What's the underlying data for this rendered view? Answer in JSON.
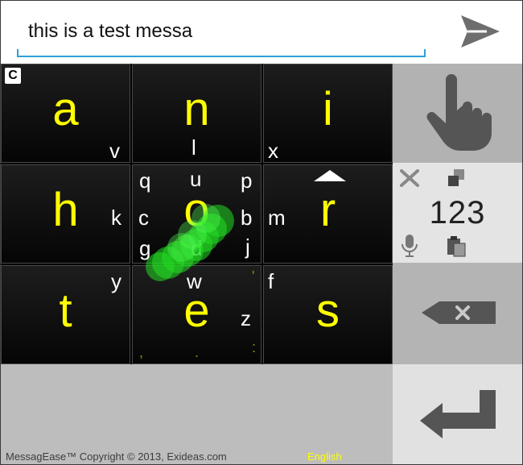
{
  "input": {
    "text": "this is a test messa"
  },
  "keyboard": {
    "mode_badge": "C",
    "cells": [
      {
        "main": "a",
        "subs": [
          "v"
        ]
      },
      {
        "main": "n",
        "subs": [
          "l"
        ]
      },
      {
        "main": "i",
        "subs": [
          "x"
        ]
      },
      {
        "main": "h",
        "subs": [
          "k"
        ]
      },
      {
        "main": "o",
        "subs": [
          "q",
          "u",
          "p",
          "c",
          "b",
          "g",
          "d",
          "j"
        ]
      },
      {
        "main": "r",
        "subs": [
          "m"
        ]
      },
      {
        "main": "t",
        "subs": [
          "y"
        ]
      },
      {
        "main": "e",
        "subs": [
          "w",
          "z",
          "'"
        ]
      },
      {
        "main": "s",
        "subs": [
          "f"
        ]
      }
    ],
    "punct_marks": [
      ",",
      ".",
      ":"
    ],
    "numbers_label": "123"
  },
  "footer": {
    "copyright": "MessagEase™ Copyright © 2013, Exideas.com",
    "language": "English"
  },
  "colors": {
    "accent_underline": "#2d9fd9",
    "letter_yellow": "#ffff00",
    "trail_green": "#22dd22"
  },
  "icons": [
    "send-icon",
    "hand-pointer-icon",
    "close-x-icon",
    "copy-icon",
    "mic-icon",
    "paste-icon",
    "backspace-icon",
    "enter-icon"
  ]
}
